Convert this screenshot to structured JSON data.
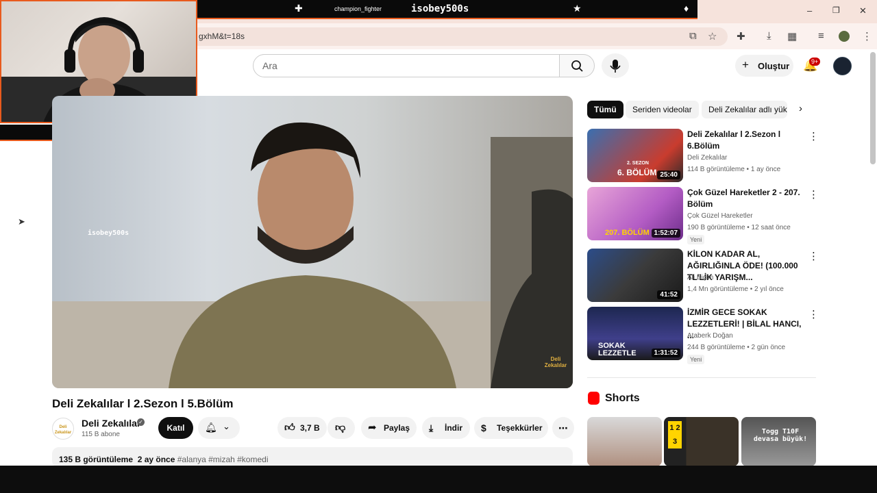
{
  "browser": {
    "url_fragment": "gxhM&t=18s",
    "window_controls": {
      "minimize": "–",
      "maximize": "❐",
      "close": "✕"
    }
  },
  "overlay": {
    "streamer_name": "isobey500s",
    "game": "champion_fighter",
    "watermark": "isobey500s"
  },
  "header": {
    "search_placeholder": "Ara",
    "create_label": "Oluştur",
    "notification_badge": "9+"
  },
  "video": {
    "title": "Deli Zekalılar l 2.Sezon l 5.Bölüm",
    "channel_name": "Deli Zekalılar",
    "channel_logo_text": "Deli Zekalılar",
    "subscribers": "115 B abone",
    "join_label": "Katıl",
    "likes": "3,7 B",
    "share_label": "Paylaş",
    "download_label": "İndir",
    "thanks_label": "Teşekkürler",
    "views": "135 B görüntüleme",
    "date": "2 ay önce",
    "tags": "#alanya #mizah #komedi",
    "corner_logo": "Deli Zekalılar"
  },
  "chips": [
    {
      "label": "Tümü"
    },
    {
      "label": "Seriden videolar"
    },
    {
      "label": "Deli Zekalılar adlı yük"
    }
  ],
  "recommendations": [
    {
      "title": "Deli Zekalılar l 2.Sezon l 6.Bölüm",
      "channel": "Deli Zekalılar",
      "meta": "114 B görüntüleme • 1 ay önce",
      "duration": "25:40",
      "thumb_text": "6. BÖLÜM",
      "thumb_sub": "2. SEZON",
      "badge": ""
    },
    {
      "title": "Çok Güzel Hareketler 2 - 207. Bölüm",
      "channel": "Çok Güzel Hareketler",
      "meta": "190 B görüntüleme • 12 saat önce",
      "duration": "1:52:07",
      "thumb_text": "207. BÖLÜM",
      "thumb_sub": "",
      "badge": "Yeni"
    },
    {
      "title": "KİLON KADAR AL, AĞIRLIĞINLA ÖDE! (100.000 TL'LİK YARIŞM...",
      "channel": "Ali Biçim",
      "meta": "1,4 Mn görüntüleme • 2 yıl önce",
      "duration": "41:52",
      "thumb_text": "",
      "thumb_sub": "",
      "badge": ""
    },
    {
      "title": "İZMİR GECE SOKAK LEZZETLERİ! | BİLAL HANCI, ...",
      "channel": "Ataberk Doğan",
      "meta": "244 B görüntüleme • 2 gün önce",
      "duration": "1:31:52",
      "thumb_text": "SOKAK LEZZETLE",
      "thumb_sub": "",
      "badge": "Yeni"
    }
  ],
  "shorts": {
    "label": "Shorts",
    "items": [
      {
        "text": ""
      },
      {
        "text": "1 2 3"
      },
      {
        "text": "Togg T10F devasa büyük!"
      }
    ]
  },
  "colors": {
    "accent_red": "#ff0000",
    "overlay_orange": "#e85a1d",
    "join_bg": "#0f0f0f"
  }
}
